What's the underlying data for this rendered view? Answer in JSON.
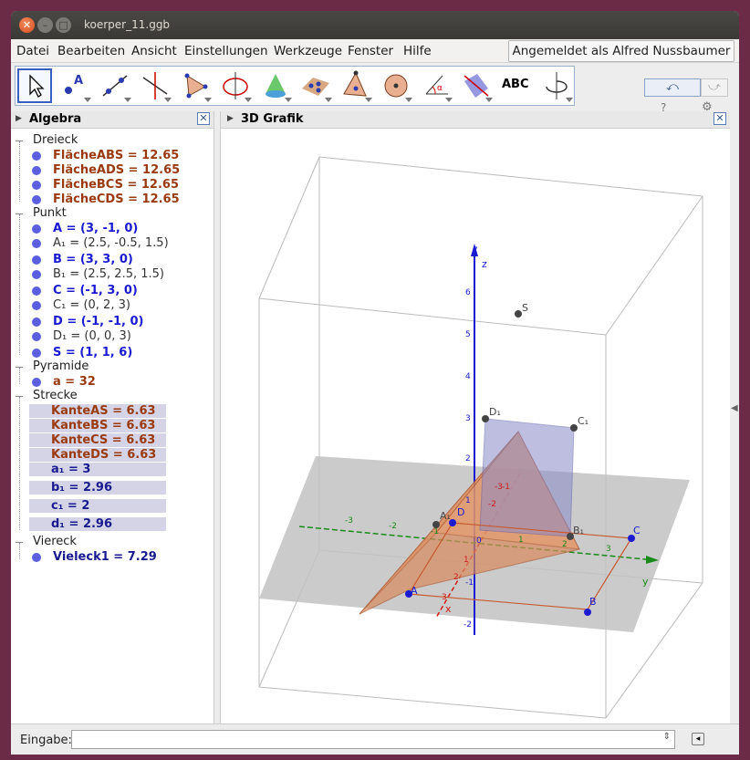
{
  "window": {
    "title": "koerper_11.ggb"
  },
  "menu": [
    "Datei",
    "Bearbeiten",
    "Ansicht",
    "Einstellungen",
    "Werkzeuge",
    "Fenster",
    "Hilfe"
  ],
  "login": "Angemeldet als Alfred Nussbaumer",
  "toolbar": {
    "tools": [
      "move-tool",
      "point-tool",
      "line-tool",
      "perpendicular-tool",
      "polygon-tool",
      "circle-tool",
      "intersect-tool",
      "plane-tool",
      "pyramid-tool",
      "sphere-tool",
      "angle-tool",
      "reflect-tool",
      "text-tool",
      "rotate-view-tool"
    ],
    "text_tool_label": "ABC",
    "help": "?",
    "undo": "⤺",
    "redo": "⤻"
  },
  "algebra": {
    "title": "Algebra",
    "groups": [
      {
        "name": "Dreieck",
        "items": [
          {
            "t": "FlächeABS = 12.65",
            "c": "#9a3a10"
          },
          {
            "t": "FlächeADS = 12.65",
            "c": "#9a3a10"
          },
          {
            "t": "FlächeBCS = 12.65",
            "c": "#9a3a10"
          },
          {
            "t": "FlächeCDS = 12.65",
            "c": "#9a3a10"
          }
        ]
      },
      {
        "name": "Punkt",
        "items": [
          {
            "t": "A = (3, -1, 0)",
            "c": "#1a1ad0"
          },
          {
            "t": "A₁ = (2.5, -0.5, 1.5)",
            "c": "#333",
            "n": 1
          },
          {
            "t": "B = (3, 3, 0)",
            "c": "#1a1ad0"
          },
          {
            "t": "B₁ = (2.5, 2.5, 1.5)",
            "c": "#333",
            "n": 1
          },
          {
            "t": "C = (-1, 3, 0)",
            "c": "#1a1ad0"
          },
          {
            "t": "C₁ = (0, 2, 3)",
            "c": "#333",
            "n": 1
          },
          {
            "t": "D = (-1, -1, 0)",
            "c": "#1a1ad0"
          },
          {
            "t": "D₁ = (0, 0, 3)",
            "c": "#333",
            "n": 1
          },
          {
            "t": "S = (1, 1, 6)",
            "c": "#1a1ad0"
          }
        ]
      },
      {
        "name": "Pyramide",
        "items": [
          {
            "t": "a = 32",
            "c": "#9a3a10"
          }
        ]
      },
      {
        "name": "Strecke",
        "items": [
          {
            "t": "KanteAS = 6.63",
            "c": "#9a3a10",
            "h": 1
          },
          {
            "t": "KanteBS = 6.63",
            "c": "#9a3a10",
            "h": 1
          },
          {
            "t": "KanteCS = 6.63",
            "c": "#9a3a10",
            "h": 1
          },
          {
            "t": "KanteDS = 6.63",
            "c": "#9a3a10",
            "h": 1
          },
          {
            "t": "a₁ = 3",
            "c": "#1a1a90",
            "h": 1
          },
          {
            "t": "b₁ = 2.96",
            "c": "#1a1a90",
            "h": 1
          },
          {
            "t": "c₁ = 2",
            "c": "#1a1a90",
            "h": 1
          },
          {
            "t": "d₁ = 2.96",
            "c": "#1a1a90",
            "h": 1
          }
        ]
      },
      {
        "name": "Viereck",
        "items": [
          {
            "t": "Vieleck1 = 7.29",
            "c": "#1a1a90"
          }
        ]
      }
    ]
  },
  "graphics": {
    "title": "3D Grafik",
    "labels": {
      "S": "S",
      "A": "A",
      "B": "B",
      "C": "C",
      "D": "D",
      "C1": "C₁",
      "D1": "D₁",
      "B1": "B₁",
      "A1": "A₁",
      "z": "z",
      "y": "y",
      "x": "x"
    },
    "z_ticks": [
      "7",
      "6",
      "5",
      "4",
      "3",
      "2",
      "1",
      "0",
      "-1",
      "-2"
    ],
    "y_ticks": [
      "-3",
      "-2",
      "-1",
      "1",
      "2",
      "3"
    ],
    "x_ticks": [
      "3",
      "2",
      "1",
      "-1",
      "-2",
      "-3"
    ]
  },
  "input": {
    "label": "Eingabe:"
  },
  "colors": {
    "pyramid": "#d98a5e",
    "square": "#8a8ac8",
    "axis_z": "#1a1ad0",
    "axis_y": "#1a8a1a",
    "axis_x": "#d01a1a"
  }
}
